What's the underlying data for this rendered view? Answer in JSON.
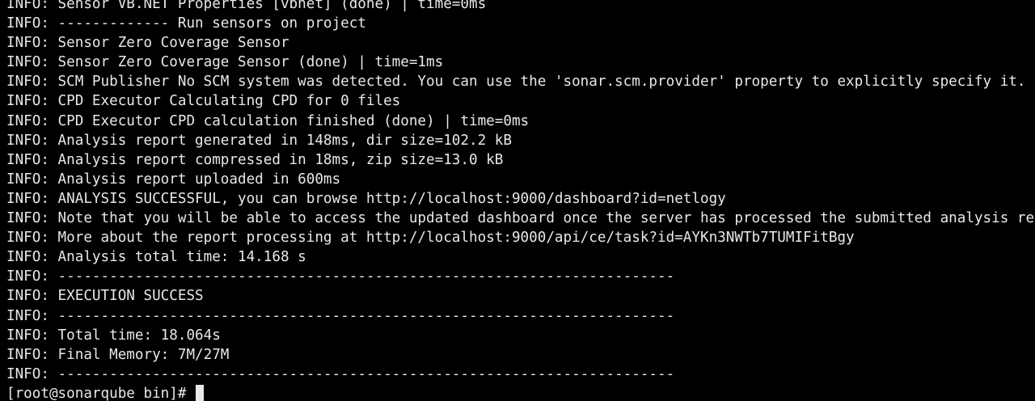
{
  "terminal": {
    "lines": [
      "INFO: Sensor VB.NET Properties [vbnet] (done) | time=0ms",
      "INFO: ------------- Run sensors on project",
      "INFO: Sensor Zero Coverage Sensor",
      "INFO: Sensor Zero Coverage Sensor (done) | time=1ms",
      "INFO: SCM Publisher No SCM system was detected. You can use the 'sonar.scm.provider' property to explicitly specify it.",
      "INFO: CPD Executor Calculating CPD for 0 files",
      "INFO: CPD Executor CPD calculation finished (done) | time=0ms",
      "INFO: Analysis report generated in 148ms, dir size=102.2 kB",
      "INFO: Analysis report compressed in 18ms, zip size=13.0 kB",
      "INFO: Analysis report uploaded in 600ms",
      "INFO: ANALYSIS SUCCESSFUL, you can browse http://localhost:9000/dashboard?id=netlogy",
      "INFO: Note that you will be able to access the updated dashboard once the server has processed the submitted analysis report",
      "INFO: More about the report processing at http://localhost:9000/api/ce/task?id=AYKn3NWTb7TUMIFitBgy",
      "INFO: Analysis total time: 14.168 s",
      "INFO: ------------------------------------------------------------------------",
      "INFO: EXECUTION SUCCESS",
      "INFO: ------------------------------------------------------------------------",
      "INFO: Total time: 18.064s",
      "INFO: Final Memory: 7M/27M",
      "INFO: ------------------------------------------------------------------------"
    ],
    "prompt": "[root@sonarqube bin]# ",
    "colors": {
      "background": "#000000",
      "foreground": "#e8e8e8"
    }
  }
}
